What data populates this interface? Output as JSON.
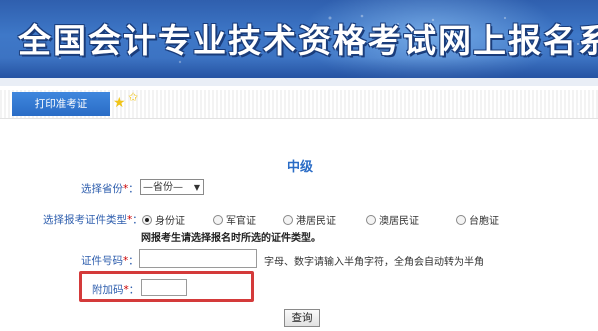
{
  "banner": {
    "title": "全国会计专业技术资格考试网上报名系统"
  },
  "tabs": {
    "print_ticket": "打印准考证"
  },
  "form": {
    "level": "中级",
    "province": {
      "label": "选择省份",
      "required_mark": "*",
      "colon": "：",
      "selected": "—省份—"
    },
    "id_type": {
      "label": "选择报考证件类型",
      "required_mark": "*",
      "colon": "：",
      "options": [
        {
          "label": "身份证",
          "checked": true
        },
        {
          "label": "军官证",
          "checked": false
        },
        {
          "label": "港居民证",
          "checked": false
        },
        {
          "label": "澳居民证",
          "checked": false
        },
        {
          "label": "台胞证",
          "checked": false
        }
      ],
      "hint": "网报考生请选择报名时所选的证件类型。"
    },
    "id_number": {
      "label": "证件号码",
      "required_mark": "*",
      "colon": "：",
      "value": "",
      "note": "字母、数字请输入半角字符，全角会自动转为半角"
    },
    "extra_code": {
      "label": "附加码",
      "required_mark": "*",
      "colon": "：",
      "value": ""
    },
    "query_button": "查询"
  },
  "colors": {
    "banner_blue": "#3e78c8",
    "tab_blue": "#2a6cc6",
    "label_blue": "#2f5fae",
    "highlight_red": "#d43a3a",
    "star": "#f0c419"
  }
}
